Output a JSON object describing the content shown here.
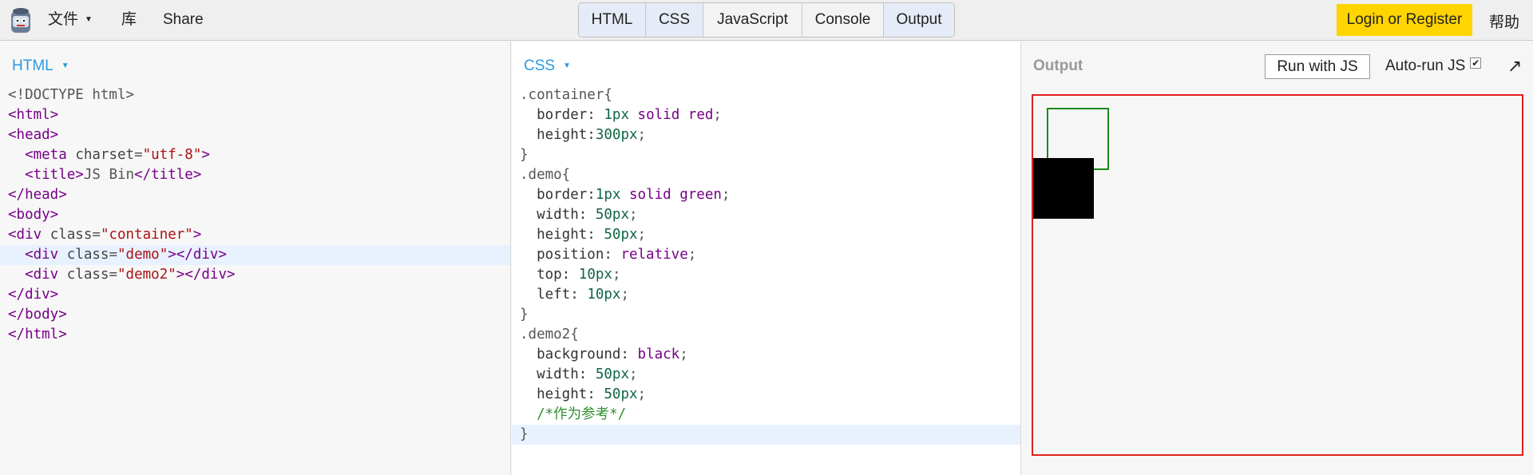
{
  "topbar": {
    "menu_file": "文件",
    "menu_library": "库",
    "menu_share": "Share",
    "tabs": [
      {
        "label": "HTML",
        "active": true
      },
      {
        "label": "CSS",
        "active": true
      },
      {
        "label": "JavaScript",
        "active": false
      },
      {
        "label": "Console",
        "active": false
      },
      {
        "label": "Output",
        "active": true
      }
    ],
    "login_label": "Login or Register",
    "help_label": "帮助",
    "accent_color": "#ffd400"
  },
  "html_panel": {
    "label": "HTML"
  },
  "css_panel": {
    "label": "CSS"
  },
  "output_panel": {
    "label": "Output",
    "run_button": "Run with JS",
    "autorun_label": "Auto-run JS",
    "autorun_checked": true,
    "popout_icon": "↗"
  }
}
